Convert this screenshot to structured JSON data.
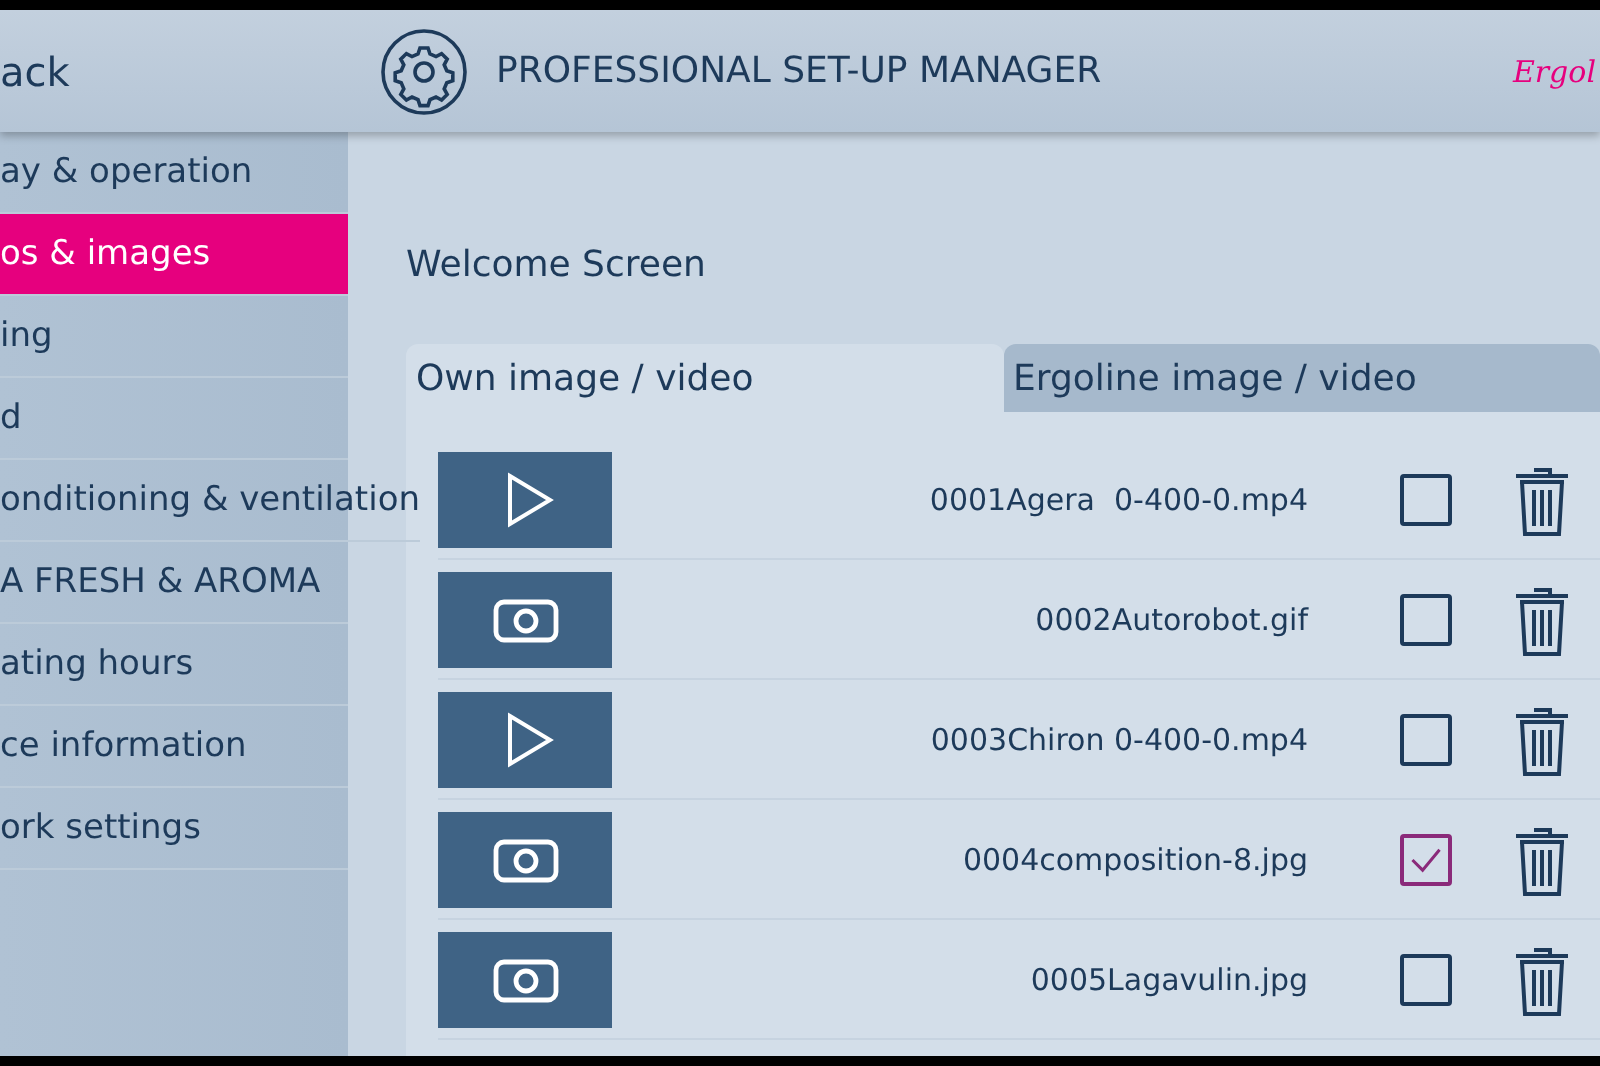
{
  "header": {
    "back": "ack",
    "title": "PROFESSIONAL SET-UP MANAGER",
    "brand": "Ergol"
  },
  "sidebar": {
    "items": [
      {
        "label": "ay & operation",
        "selected": false
      },
      {
        "label": "os & images",
        "selected": true
      },
      {
        "label": "ing",
        "selected": false
      },
      {
        "label": "d",
        "selected": false
      },
      {
        "label": "onditioning & ventilation",
        "selected": false
      },
      {
        "label": "A FRESH & AROMA",
        "selected": false
      },
      {
        "label": "ating hours",
        "selected": false
      },
      {
        "label": "ce information",
        "selected": false
      },
      {
        "label": "ork settings",
        "selected": false
      }
    ]
  },
  "section_title": "Welcome Screen",
  "tabs": [
    {
      "label": "Own image / video",
      "selected": true
    },
    {
      "label": "Ergoline image / video",
      "selected": false
    }
  ],
  "files": [
    {
      "kind": "video",
      "name": "0001Agera  0-400-0.mp4",
      "checked": false
    },
    {
      "kind": "image",
      "name": "0002Autorobot.gif",
      "checked": false
    },
    {
      "kind": "video",
      "name": "0003Chiron 0-400-0.mp4",
      "checked": false
    },
    {
      "kind": "image",
      "name": "0004composition-8.jpg",
      "checked": true
    },
    {
      "kind": "image",
      "name": "0005Lagavulin.jpg",
      "checked": false
    }
  ]
}
